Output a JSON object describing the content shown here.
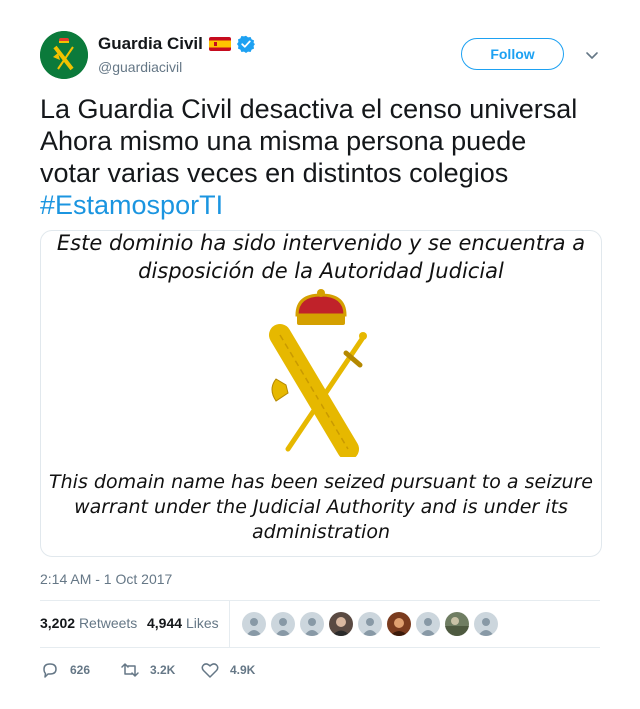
{
  "author": {
    "name": "Guardia Civil",
    "handle": "@guardiacivil",
    "flag_icon": "spain-flag-icon",
    "verified_icon": "verified-badge-icon",
    "avatar_color": "#0b7a3b"
  },
  "header": {
    "follow_label": "Follow",
    "menu_icon": "chevron-down-icon"
  },
  "tweet": {
    "lines": [
      "La Guardia Civil desactiva el censo universal",
      "Ahora mismo una misma persona puede",
      "votar varias veces en distintos colegios"
    ],
    "hashtag": "#EstamosporTI"
  },
  "media": {
    "spanish_lines": [
      "Este dominio ha sido intervenido y se encuentra a",
      "disposición de la Autoridad Judicial"
    ],
    "english_lines": [
      "This domain name has been seized pursuant to a seizure",
      "warrant under the Judicial Authority and is under its",
      "administration"
    ],
    "emblem_icon": "guardia-civil-emblem-icon"
  },
  "timestamp": "2:14 AM - 1 Oct 2017",
  "stats": {
    "retweets_count": "3,202",
    "retweets_label": "Retweets",
    "likes_count": "4,944",
    "likes_label": "Likes"
  },
  "actions": {
    "reply_count": "626",
    "retweet_count": "3.2K",
    "like_count": "4.9K"
  },
  "colors": {
    "link_blue": "#1b95e0",
    "follow_blue": "#1da1f2",
    "muted_gray": "#657786"
  }
}
